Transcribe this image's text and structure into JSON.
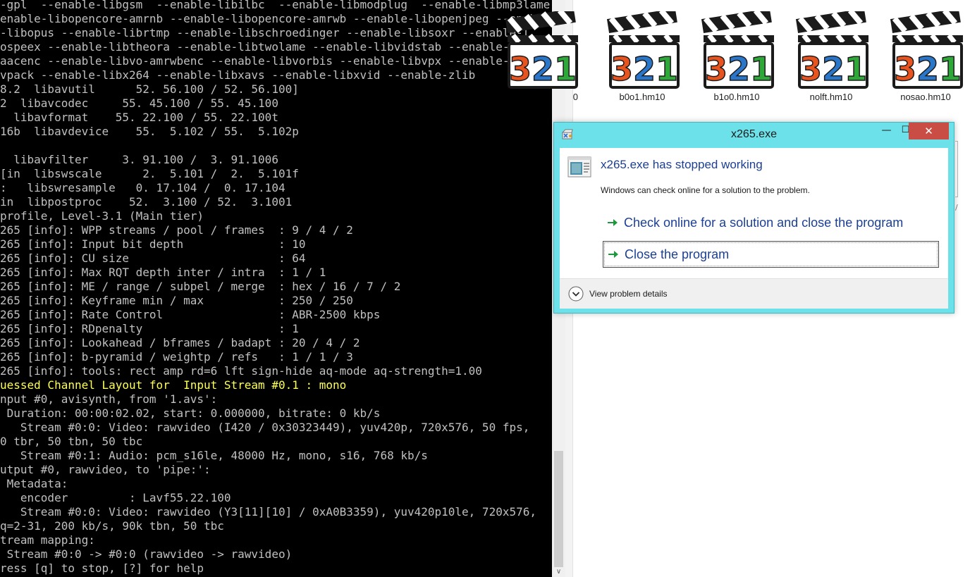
{
  "console": {
    "lines": [
      {
        "text": "-gpl  --enable-libgsm  --enable-libilbc  --enable-libmodplug  --enable-libmp3lame",
        "style": "normal"
      },
      {
        "text": "enable-libopencore-amrnb --enable-libopencore-amrwb --enable-libopenjpeg --enab",
        "style": "normal"
      },
      {
        "text": "-libopus --enable-librtmp --enable-libschroedinger --enable-libsoxr --enable-l",
        "style": "normal"
      },
      {
        "text": "ospeex --enable-libtheora --enable-libtwolame --enable-libvidstab --enable-libv",
        "style": "normal"
      },
      {
        "text": "aacenc --enable-libvo-amrwbenc --enable-libvorbis --enable-libvpx --enable-lib",
        "style": "normal"
      },
      {
        "text": "vpack --enable-libx264 --enable-libxavs --enable-libxvid --enable-zlib",
        "style": "normal"
      },
      {
        "text": "8.2  libavutil      52. 56.100 / 52. 56.100]",
        "style": "normal"
      },
      {
        "text": "2  libavcodec     55. 45.100 / 55. 45.100",
        "style": "normal"
      },
      {
        "text": "  libavformat    55. 22.100 / 55. 22.100t",
        "style": "normal"
      },
      {
        "text": "16b  libavdevice    55.  5.102 / 55.  5.102p",
        "style": "normal"
      },
      {
        "text": "",
        "style": "normal"
      },
      {
        "text": "  libavfilter     3. 91.100 /  3. 91.1006",
        "style": "normal"
      },
      {
        "text": "[in  libswscale      2.  5.101 /  2.  5.101f",
        "style": "normal"
      },
      {
        "text": ":   libswresample   0. 17.104 /  0. 17.104",
        "style": "normal"
      },
      {
        "text": "in  libpostproc    52.  3.100 / 52.  3.1001",
        "style": "normal"
      },
      {
        "text": "profile, Level-3.1 (Main tier)",
        "style": "normal"
      },
      {
        "text": "265 [info]: WPP streams / pool / frames  : 9 / 4 / 2",
        "style": "normal"
      },
      {
        "text": "265 [info]: Input bit depth              : 10",
        "style": "normal"
      },
      {
        "text": "265 [info]: CU size                      : 64",
        "style": "normal"
      },
      {
        "text": "265 [info]: Max RQT depth inter / intra  : 1 / 1",
        "style": "normal"
      },
      {
        "text": "265 [info]: ME / range / subpel / merge  : hex / 16 / 7 / 2",
        "style": "normal"
      },
      {
        "text": "265 [info]: Keyframe min / max           : 250 / 250",
        "style": "normal"
      },
      {
        "text": "265 [info]: Rate Control                 : ABR-2500 kbps",
        "style": "normal"
      },
      {
        "text": "265 [info]: RDpenalty                    : 1",
        "style": "normal"
      },
      {
        "text": "265 [info]: Lookahead / bframes / badapt : 20 / 4 / 2",
        "style": "normal"
      },
      {
        "text": "265 [info]: b-pyramid / weightp / refs   : 1 / 1 / 3",
        "style": "normal"
      },
      {
        "text": "265 [info]: tools: rect amp rd=6 lft sign-hide aq-mode aq-strength=1.00",
        "style": "normal"
      },
      {
        "text": "uessed Channel Layout for  Input Stream #0.1 : mono",
        "style": "warn"
      },
      {
        "text": "nput #0, avisynth, from '1.avs':",
        "style": "normal"
      },
      {
        "text": " Duration: 00:00:02.02, start: 0.000000, bitrate: 0 kb/s",
        "style": "normal"
      },
      {
        "text": "   Stream #0:0: Video: rawvideo (I420 / 0x30323449), yuv420p, 720x576, 50 fps,",
        "style": "normal"
      },
      {
        "text": "0 tbr, 50 tbn, 50 tbc",
        "style": "normal"
      },
      {
        "text": "   Stream #0:1: Audio: pcm_s16le, 48000 Hz, mono, s16, 768 kb/s",
        "style": "normal"
      },
      {
        "text": "utput #0, rawvideo, to 'pipe:':",
        "style": "normal"
      },
      {
        "text": " Metadata:",
        "style": "normal"
      },
      {
        "text": "   encoder         : Lavf55.22.100",
        "style": "normal"
      },
      {
        "text": "   Stream #0:0: Video: rawvideo (Y3[11][10] / 0xA0B3359), yuv420p10le, 720x576,",
        "style": "normal"
      },
      {
        "text": "q=2-31, 200 kb/s, 90k tbn, 50 tbc",
        "style": "normal"
      },
      {
        "text": "tream mapping:",
        "style": "normal"
      },
      {
        "text": " Stream #0:0 -> #0:0 (rawvideo -> rawvideo)",
        "style": "normal"
      },
      {
        "text": "ress [q] to stop, [?] for help",
        "style": "normal"
      }
    ],
    "scroll_down_glyph": "∨"
  },
  "explorer": {
    "files": [
      {
        "label": "0",
        "icon": "mpc-hc-321-icon",
        "partial": true
      },
      {
        "label": "b0o1.hm10",
        "icon": "mpc-hc-321-icon"
      },
      {
        "label": "b1o0.hm10",
        "icon": "mpc-hc-321-icon"
      },
      {
        "label": "nolft.hm10",
        "icon": "mpc-hc-321-icon"
      },
      {
        "label": "nosao.hm10",
        "icon": "mpc-hc-321-icon"
      }
    ],
    "icon_text": "321",
    "background_mark": "/"
  },
  "dialog": {
    "title": "x265.exe",
    "minimize_glyph": "—",
    "maximize_glyph": "☐",
    "close_glyph": "✕",
    "main_instruction": "x265.exe has stopped working",
    "content": "Windows can check online for a solution to the problem.",
    "options": [
      {
        "label": "Check online for a solution and close the program"
      },
      {
        "label": "Close the program"
      }
    ],
    "details_label": "View problem details"
  },
  "colors": {
    "frame": "#6de1e9",
    "close_button": "#c94d45",
    "link_text": "#1c3f94",
    "arrow_green": "#1a9a3a",
    "console_text": "#c0c0c0",
    "console_warn": "#ffff55"
  }
}
